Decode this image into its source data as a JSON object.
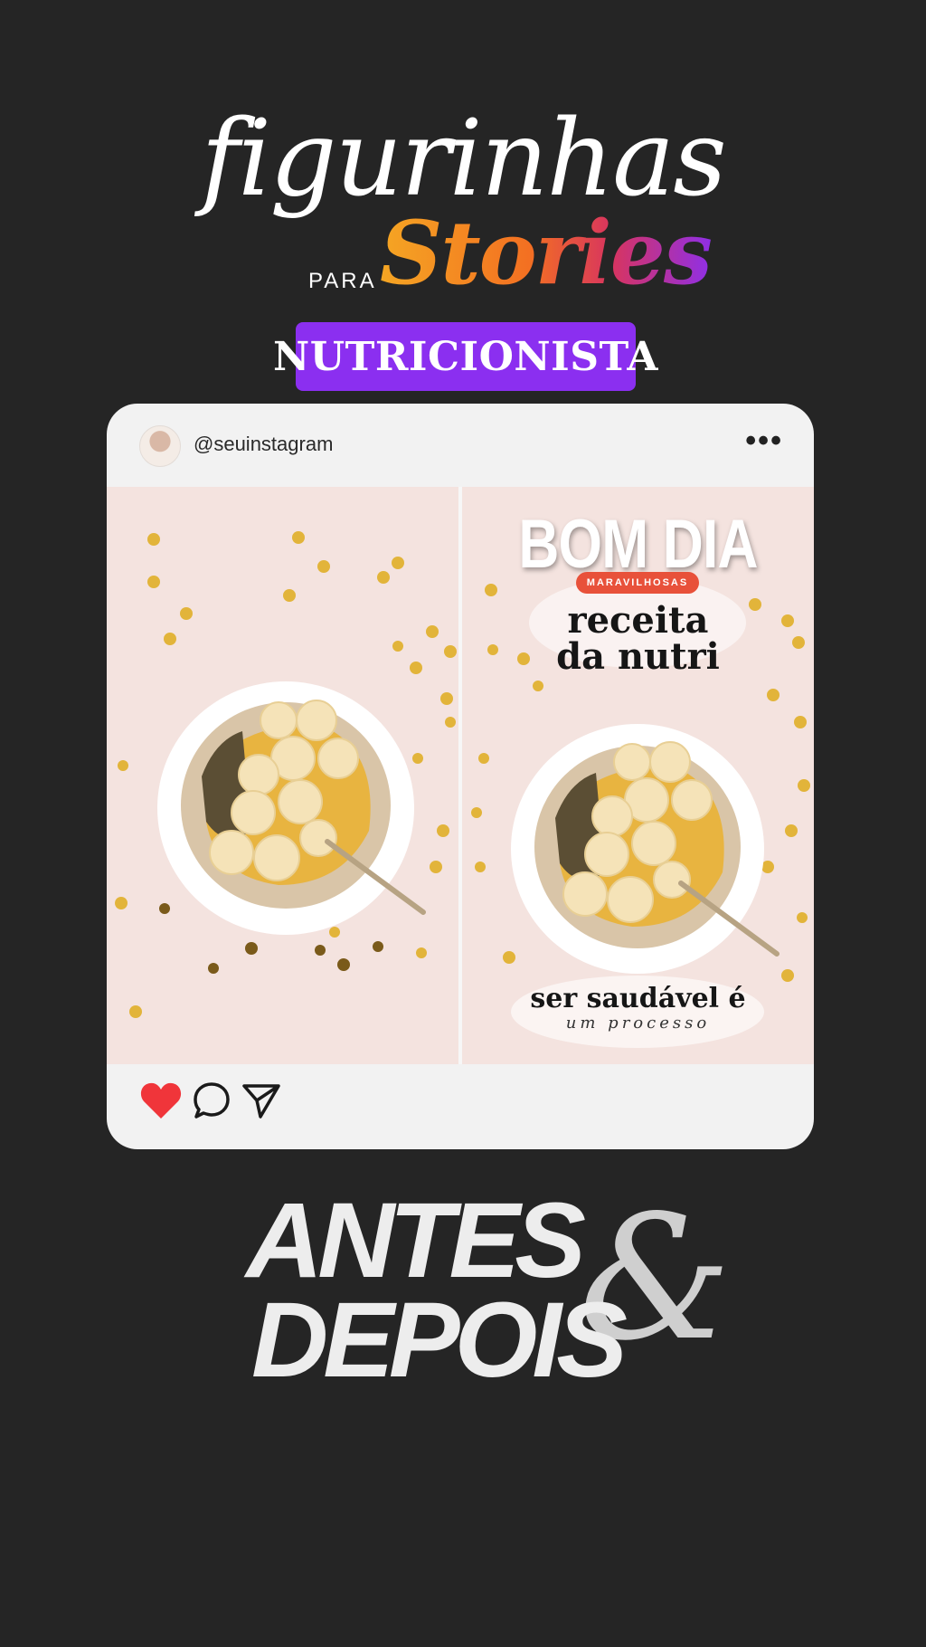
{
  "header": {
    "script_title": "figurinhas",
    "para": "PARA",
    "stories": "Stories",
    "badge": "NUTRICIONISTA"
  },
  "post": {
    "username": "@seuinstagram",
    "more": "•••",
    "right_photo": {
      "headline": "BOM DIA",
      "tag": "MARAVILHOSAS",
      "recipe_line1": "receita",
      "recipe_line2": "da nutri",
      "footer_line1": "ser saudável é",
      "footer_line2": "um processo"
    },
    "icons": [
      "avatar-image",
      "more-options-icon",
      "heart-icon",
      "comment-icon",
      "share-icon"
    ]
  },
  "footer": {
    "antes": "ANTES",
    "ampersand": "&",
    "depois": "DEPOIS"
  },
  "colors": {
    "background": "#252525",
    "badge": "#8b2ff0",
    "heart": "#f0353a",
    "card": "#f2f2f2"
  }
}
